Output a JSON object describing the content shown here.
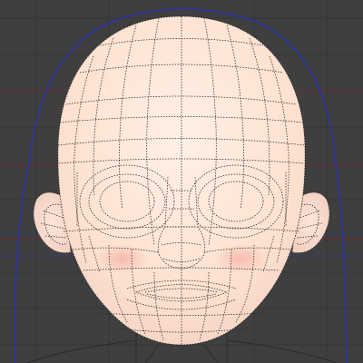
{
  "viewport": {
    "background_color": "#3f3f3f",
    "grid_color": "#353535",
    "grid_major_red_color": "#7a2a3a",
    "grid_major_blue_color": "#2c3d73",
    "outline_color": "#2a33a8",
    "skin_color": "#fde1d0",
    "skin_shadow_color": "#f3cfc0",
    "cheek_color": "#f4b2a6",
    "wire_color": "#222222"
  }
}
